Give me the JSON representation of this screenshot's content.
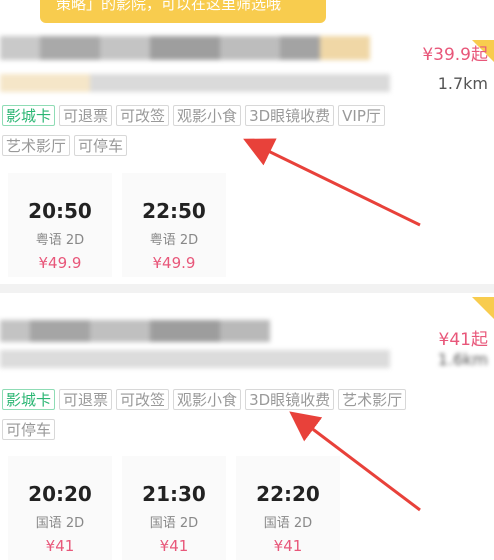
{
  "toast": {
    "text": "策略」的影院，可以在这里筛选哦"
  },
  "cinemas": [
    {
      "price": "¥39.9起",
      "distance": "1.7km",
      "tags_row1": [
        "影城卡",
        "可退票",
        "可改签",
        "观影小食",
        "3D眼镜收费",
        "VIP厅"
      ],
      "tags_row2": [
        "艺术影厅",
        "可停车"
      ],
      "shows": [
        {
          "time": "20:50",
          "lang": "粤语 2D",
          "price": "¥49.9"
        },
        {
          "time": "22:50",
          "lang": "粤语 2D",
          "price": "¥49.9"
        }
      ]
    },
    {
      "price": "¥41起",
      "distance": "1.6km",
      "tags_row1": [
        "影城卡",
        "可退票",
        "可改签",
        "观影小食",
        "3D眼镜收费",
        "艺术影厅"
      ],
      "tags_row2": [
        "可停车"
      ],
      "shows": [
        {
          "time": "20:20",
          "lang": "国语 2D",
          "price": "¥41"
        },
        {
          "time": "21:30",
          "lang": "国语 2D",
          "price": "¥41"
        },
        {
          "time": "22:20",
          "lang": "国语 2D",
          "price": "¥41"
        }
      ]
    }
  ],
  "colors": {
    "accent": "#e8577a",
    "tag_green": "#2bb673",
    "toast": "#f8cc4e",
    "arrow": "#e8413a"
  }
}
